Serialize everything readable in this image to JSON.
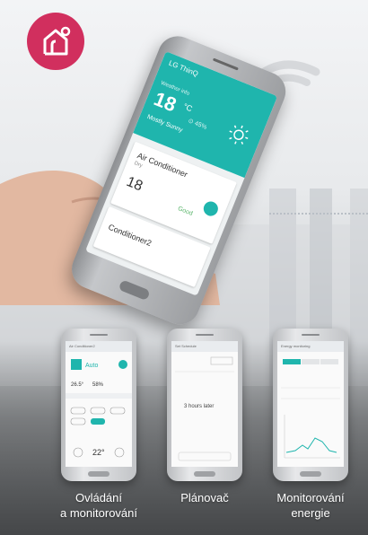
{
  "brand": {
    "color": "#d12f5e",
    "icon": "smart-home-icon"
  },
  "phone_screen": {
    "app_name": "LG ThinQ",
    "weather_city": "Weather info",
    "temperature": "18",
    "temperature_unit": "°C",
    "humidity": "⊙ 45%",
    "condition": "Mostly Sunny",
    "device1_name": "Air Conditioner",
    "device1_mode": "Dry",
    "device1_value": "18",
    "device1_status": "Good",
    "device2_name": "Conditioner2"
  },
  "mini_screens": {
    "control": {
      "header": "Air Conditioner2",
      "mode": "Auto",
      "temp_a": "26.5°",
      "temp_b": "58%",
      "temp_set": "22°"
    },
    "schedule": {
      "header": "Set Schedule",
      "body": "3 hours later"
    },
    "energy": {
      "header": "Energy monitoring"
    }
  },
  "captions": {
    "control_line1": "Ovládání",
    "control_line2": "a monitorování",
    "schedule": "Plánovač",
    "energy_line1": "Monitorování",
    "energy_line2": "energie"
  },
  "colors": {
    "accent": "#1fb5ad",
    "good": "#5ab56b"
  }
}
